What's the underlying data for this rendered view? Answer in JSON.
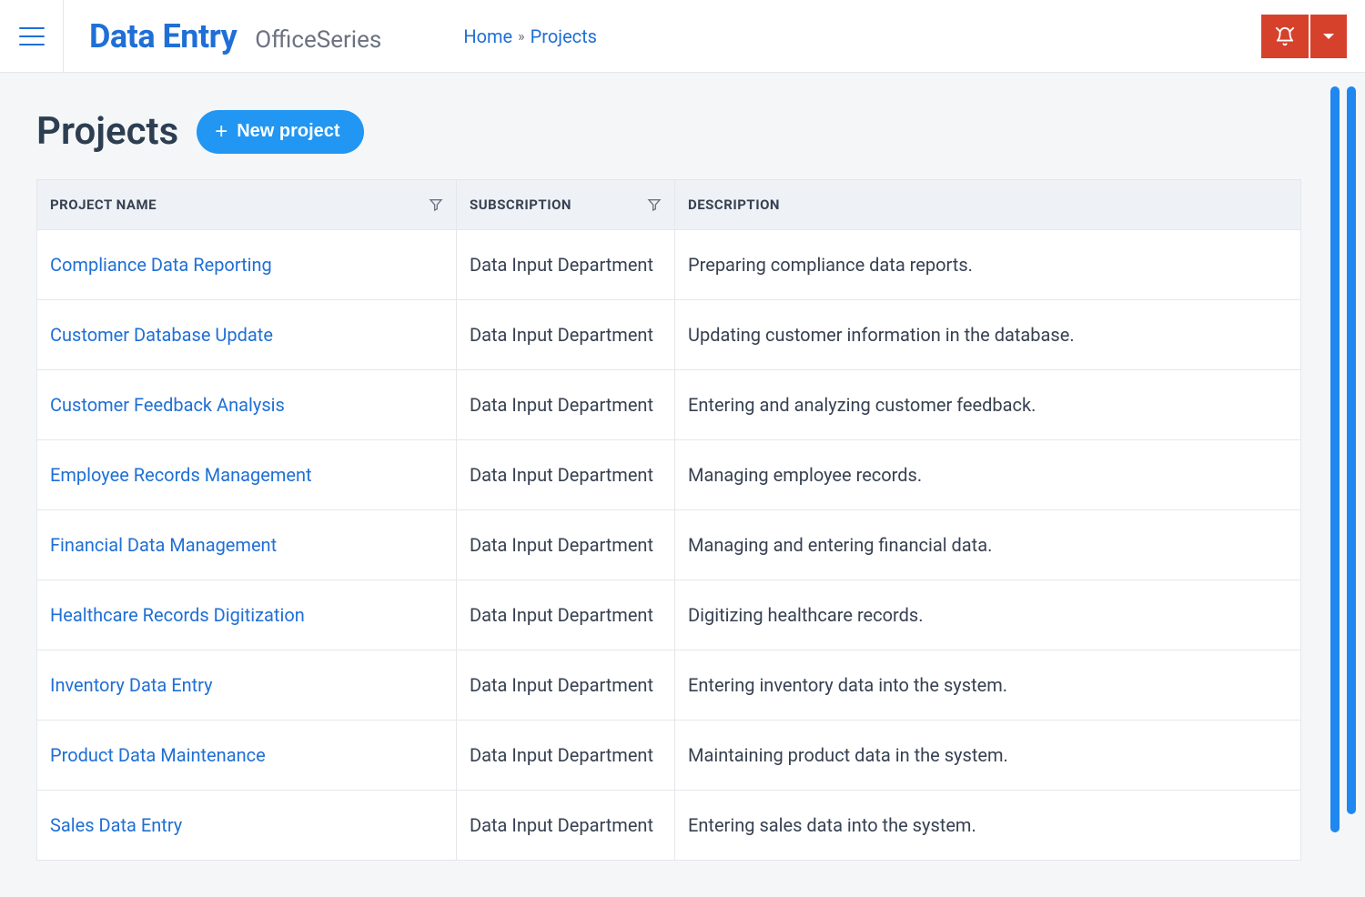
{
  "header": {
    "brand_title": "Data Entry",
    "brand_subtitle": "OfficeSeries",
    "breadcrumb_home": "Home",
    "breadcrumb_current": "Projects"
  },
  "page": {
    "title": "Projects",
    "new_button_label": "New project"
  },
  "table": {
    "columns": {
      "name": "Project Name",
      "subscription": "Subscription",
      "description": "Description"
    },
    "rows": [
      {
        "name": "Compliance Data Reporting",
        "subscription": "Data Input Department",
        "description": "Preparing compliance data reports."
      },
      {
        "name": "Customer Database Update",
        "subscription": "Data Input Department",
        "description": "Updating customer information in the database."
      },
      {
        "name": "Customer Feedback Analysis",
        "subscription": "Data Input Department",
        "description": "Entering and analyzing customer feedback."
      },
      {
        "name": "Employee Records Management",
        "subscription": "Data Input Department",
        "description": "Managing employee records."
      },
      {
        "name": "Financial Data Management",
        "subscription": "Data Input Department",
        "description": "Managing and entering financial data."
      },
      {
        "name": "Healthcare Records Digitization",
        "subscription": "Data Input Department",
        "description": "Digitizing healthcare records."
      },
      {
        "name": "Inventory Data Entry",
        "subscription": "Data Input Department",
        "description": "Entering inventory data into the system."
      },
      {
        "name": "Product Data Maintenance",
        "subscription": "Data Input Department",
        "description": "Maintaining product data in the system."
      },
      {
        "name": "Sales Data Entry",
        "subscription": "Data Input Department",
        "description": "Entering sales data into the system."
      }
    ]
  }
}
